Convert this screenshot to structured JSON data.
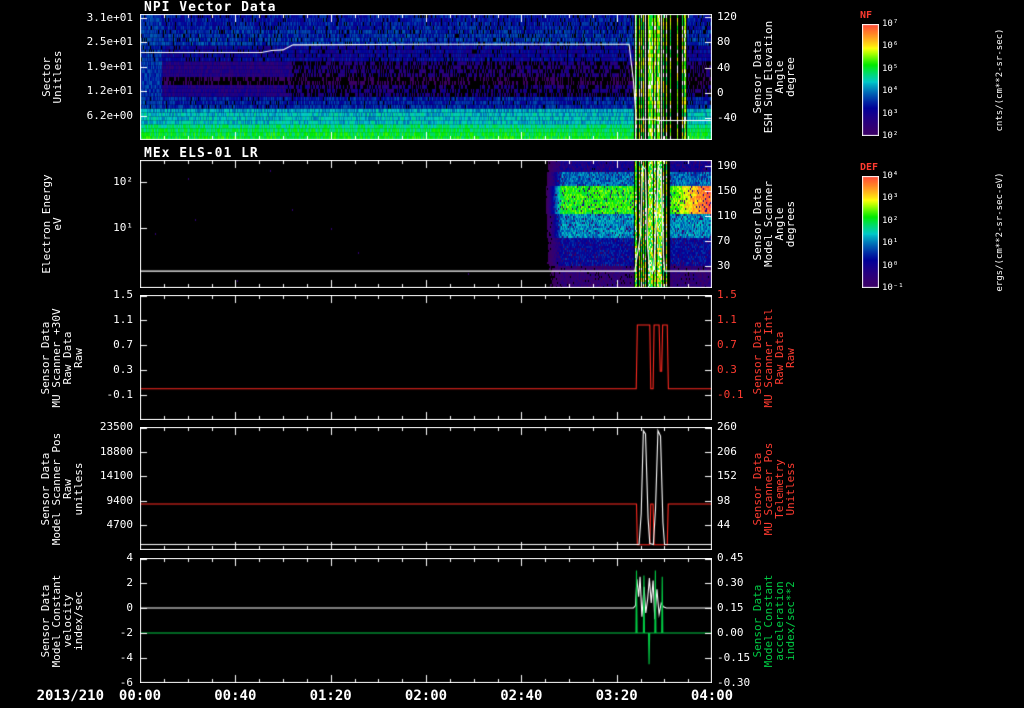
{
  "figure": {
    "background": "#000000",
    "date_label": "2013/210",
    "x_axis": {
      "tick_labels": [
        "00:00",
        "00:40",
        "01:20",
        "02:00",
        "02:40",
        "03:20",
        "04:00"
      ],
      "range_hours": [
        0,
        4
      ]
    }
  },
  "chart_data": [
    {
      "type": "heatmap",
      "title": "NPI Vector Data",
      "left_axis": {
        "label": "Sector\nUnitless",
        "scale": "linear",
        "ylim": [
          0,
          32
        ],
        "ticks": [
          {
            "label": "3.1e+01",
            "value": 31
          },
          {
            "label": "2.5e+01",
            "value": 24.8
          },
          {
            "label": "1.9e+01",
            "value": 18.6
          },
          {
            "label": "1.2e+01",
            "value": 12.4
          },
          {
            "label": "6.2e+00",
            "value": 6.2
          }
        ]
      },
      "right_axis": {
        "label": "Sensor Data\nESH Sun Elevation\nAngle\ndegree",
        "scale": "linear",
        "ylim": [
          -75,
          125
        ],
        "tick_color": "#ffffff",
        "label_color": "#ffffff",
        "ticks": [
          {
            "label": "120",
            "value": 120
          },
          {
            "label": "80",
            "value": 80
          },
          {
            "label": "40",
            "value": 40
          },
          {
            "label": "0",
            "value": 0
          },
          {
            "label": "-40",
            "value": -40
          }
        ]
      },
      "heatmap": {
        "rows": 32,
        "sector_intensity_profile": [
          0.63,
          0.62,
          0.6,
          0.57,
          0.5,
          0.5,
          0.5,
          0.48,
          0.34,
          0.33,
          0.33,
          0.22,
          0.22,
          0.2,
          0.03,
          0.03,
          0.2,
          0.2,
          0.2,
          0.2,
          0.29,
          0.28,
          0.28,
          0.28,
          0.36,
          0.36,
          0.35,
          0.35,
          0.33,
          0.33,
          0.32,
          0.32
        ],
        "uniform_start_hours": 0.15,
        "event_window_hours": [
          3.45,
          3.82
        ],
        "event_mid_hours": 3.63
      },
      "overlays": [
        {
          "name": "sun-elevation-angle-line",
          "color": "#ffffff",
          "axis": "right",
          "points": [
            [
              0,
              64
            ],
            [
              0.85,
              64
            ],
            [
              0.92,
              67
            ],
            [
              1.0,
              68
            ],
            [
              1.07,
              76
            ],
            [
              2.0,
              77
            ],
            [
              3.0,
              77
            ],
            [
              3.42,
              77
            ],
            [
              3.45,
              20
            ],
            [
              3.47,
              -42
            ],
            [
              3.6,
              -42
            ],
            [
              3.62,
              -44
            ],
            [
              4,
              -44
            ]
          ]
        }
      ],
      "colorbar": {
        "title": "NF",
        "unit": "cnts/(cm**2-sr-sec)",
        "ticks": [
          "10⁷",
          "10⁶",
          "10⁵",
          "10⁴",
          "10³",
          "10²"
        ]
      }
    },
    {
      "type": "heatmap",
      "title": "MEx ELS-01 LR",
      "left_axis": {
        "label": "Electron Energy\neV",
        "scale": "log",
        "ylim": [
          0.5,
          300
        ],
        "ticks": [
          {
            "label": "10²",
            "value": 100
          },
          {
            "label": "10¹",
            "value": 10
          }
        ]
      },
      "right_axis": {
        "label": "Sensor Data\nModel Scanner\nAngle\ndegrees",
        "scale": "linear",
        "ylim": [
          -5,
          200
        ],
        "tick_color": "#ffffff",
        "label_color": "#ffffff",
        "ticks": [
          {
            "label": "190",
            "value": 190
          },
          {
            "label": "150",
            "value": 150
          },
          {
            "label": "110",
            "value": 110
          },
          {
            "label": "70",
            "value": 70
          },
          {
            "label": "30",
            "value": 30
          }
        ]
      },
      "heatmap": {
        "start_hours": 2.83,
        "event_window_hours": [
          3.45,
          3.7
        ],
        "bands": [
          {
            "f0": 0.0,
            "f1": 0.18,
            "v": 0.14
          },
          {
            "f0": 0.18,
            "f1": 0.4,
            "v": 0.3
          },
          {
            "f0": 0.4,
            "f1": 0.58,
            "v": 0.46
          },
          {
            "f0": 0.58,
            "f1": 0.8,
            "v": 0.66
          },
          {
            "f0": 0.8,
            "f1": 0.92,
            "v": 0.42
          },
          {
            "f0": 0.92,
            "f1": 1.01,
            "v": 0.24
          }
        ],
        "post_event_hot_band": {
          "f0": 0.58,
          "f1": 0.8,
          "max_boost": 0.3
        }
      },
      "overlays": [
        {
          "name": "scanner-angle-line",
          "color": "#ffffff",
          "axis": "right",
          "points": [
            [
              0,
              22
            ],
            [
              3.46,
              22
            ],
            [
              3.5,
              80
            ],
            [
              3.515,
              190
            ],
            [
              3.535,
              185
            ],
            [
              3.55,
              60
            ],
            [
              3.565,
              22
            ],
            [
              3.59,
              22
            ],
            [
              3.61,
              95
            ],
            [
              3.625,
              190
            ],
            [
              3.645,
              180
            ],
            [
              3.66,
              50
            ],
            [
              3.67,
              22
            ],
            [
              4,
              22
            ]
          ]
        }
      ],
      "colorbar": {
        "title": "DEF",
        "unit": "ergs/(cm**2-sr-sec-eV)",
        "ticks": [
          "10⁴",
          "10³",
          "10²",
          "10¹",
          "10⁰",
          "10⁻¹"
        ]
      }
    },
    {
      "type": "line",
      "title": "",
      "left_axis": {
        "label": "Sensor Data\nMU Scanner +30V\nRaw Data\nRaw",
        "scale": "linear",
        "ylim": [
          -0.5,
          1.5
        ],
        "ticks": [
          {
            "label": "1.5",
            "value": 1.5
          },
          {
            "label": "1.1",
            "value": 1.1
          },
          {
            "label": "0.7",
            "value": 0.7
          },
          {
            "label": "0.3",
            "value": 0.3
          },
          {
            "label": "-0.1",
            "value": -0.1
          }
        ]
      },
      "right_axis": {
        "label": "Sensor Data\nMU Scanner Intl\nRaw Data\nRaw",
        "scale": "linear",
        "ylim": [
          -0.5,
          1.5
        ],
        "tick_color": "#ff3b30",
        "label_color": "#ff3b30",
        "ticks": [
          {
            "label": "1.5",
            "value": 1.5
          },
          {
            "label": "1.1",
            "value": 1.1
          },
          {
            "label": "0.7",
            "value": 0.7
          },
          {
            "label": "0.3",
            "value": 0.3
          },
          {
            "label": "-0.1",
            "value": -0.1
          }
        ]
      },
      "series": [
        {
          "name": "mu-scanner-raw",
          "color": "#ff2a20",
          "axis": "left",
          "points": [
            [
              0,
              0
            ],
            [
              3.47,
              0
            ],
            [
              3.478,
              1.02
            ],
            [
              3.565,
              1.02
            ],
            [
              3.572,
              0
            ],
            [
              3.588,
              0
            ],
            [
              3.595,
              1.02
            ],
            [
              3.63,
              1.02
            ],
            [
              3.638,
              0.28
            ],
            [
              3.648,
              0.28
            ],
            [
              3.655,
              1.02
            ],
            [
              3.687,
              1.02
            ],
            [
              3.695,
              0
            ],
            [
              4,
              0
            ]
          ]
        }
      ]
    },
    {
      "type": "line",
      "title": "",
      "left_axis": {
        "label": "Sensor Data\nModel Scanner Pos\nRaw\nunitless",
        "scale": "linear",
        "ylim": [
          0,
          23500
        ],
        "ticks": [
          {
            "label": "23500",
            "value": 23500
          },
          {
            "label": "18800",
            "value": 18800
          },
          {
            "label": "14100",
            "value": 14100
          },
          {
            "label": "9400",
            "value": 9400
          },
          {
            "label": "4700",
            "value": 4700
          }
        ]
      },
      "right_axis": {
        "label": "Sensor Data\nMU Scanner Pos\nTelemetry\nUnitless",
        "scale": "linear",
        "ylim": [
          -10,
          260
        ],
        "tick_color": "#ffffff",
        "label_color": "#ff3b30",
        "ticks": [
          {
            "label": "260",
            "value": 260
          },
          {
            "label": "206",
            "value": 206
          },
          {
            "label": "152",
            "value": 152
          },
          {
            "label": "98",
            "value": 98
          },
          {
            "label": "44",
            "value": 44
          }
        ]
      },
      "series": [
        {
          "name": "model-scanner-pos-raw",
          "color": "#ff2a20",
          "axis": "left",
          "points": [
            [
              0,
              8800
            ],
            [
              3.472,
              8800
            ],
            [
              3.478,
              1000
            ],
            [
              3.565,
              1000
            ],
            [
              3.572,
              8800
            ],
            [
              3.588,
              8800
            ],
            [
              3.595,
              1000
            ],
            [
              3.687,
              1000
            ],
            [
              3.694,
              8800
            ],
            [
              4,
              8800
            ]
          ]
        },
        {
          "name": "mu-scanner-pos-telemetry",
          "color": "#ffffff",
          "axis": "right",
          "points": [
            [
              0,
              2
            ],
            [
              3.46,
              2
            ],
            [
              3.49,
              2
            ],
            [
              3.505,
              70
            ],
            [
              3.52,
              252
            ],
            [
              3.535,
              245
            ],
            [
              3.553,
              60
            ],
            [
              3.565,
              4
            ],
            [
              3.59,
              2
            ],
            [
              3.605,
              80
            ],
            [
              3.622,
              252
            ],
            [
              3.64,
              240
            ],
            [
              3.657,
              50
            ],
            [
              3.668,
              2
            ],
            [
              4,
              2
            ]
          ]
        }
      ]
    },
    {
      "type": "line",
      "title": "",
      "left_axis": {
        "label": "Sensor Data\nModel Constant\nvelocity\nindex/sec",
        "scale": "linear",
        "ylim": [
          -6,
          4
        ],
        "ticks": [
          {
            "label": "4",
            "value": 4
          },
          {
            "label": "2",
            "value": 2
          },
          {
            "label": "0",
            "value": 0
          },
          {
            "label": "-2",
            "value": -2
          },
          {
            "label": "-4",
            "value": -4
          },
          {
            "label": "-6",
            "value": -6
          }
        ]
      },
      "right_axis": {
        "label": "Sensor Data\nModel Constant\nacceleration\nindex/sec**2",
        "scale": "linear",
        "ylim": [
          -0.3,
          0.45
        ],
        "tick_color": "#ffffff",
        "label_color": "#00cc44",
        "ticks": [
          {
            "label": "0.45",
            "value": 0.45
          },
          {
            "label": "0.30",
            "value": 0.3
          },
          {
            "label": "0.15",
            "value": 0.15
          },
          {
            "label": "0.00",
            "value": 0.0
          },
          {
            "label": "-0.15",
            "value": -0.15
          },
          {
            "label": "-0.30",
            "value": -0.3
          }
        ]
      },
      "series": [
        {
          "name": "model-constant-velocity",
          "color": "#ffffff",
          "axis": "left",
          "points": [
            [
              0,
              0
            ],
            [
              3.45,
              0
            ],
            [
              3.465,
              0.2
            ],
            [
              3.475,
              2.3
            ],
            [
              3.487,
              0.9
            ],
            [
              3.497,
              2.5
            ],
            [
              3.51,
              -0.7
            ],
            [
              3.525,
              1.7
            ],
            [
              3.537,
              -0.4
            ],
            [
              3.55,
              0.7
            ],
            [
              3.562,
              2.4
            ],
            [
              3.575,
              0.4
            ],
            [
              3.588,
              2.2
            ],
            [
              3.6,
              -0.9
            ],
            [
              3.615,
              1.5
            ],
            [
              3.63,
              -0.5
            ],
            [
              3.645,
              0.4
            ],
            [
              3.66,
              0.1
            ],
            [
              3.68,
              0
            ],
            [
              4,
              0
            ]
          ]
        },
        {
          "name": "model-constant-acceleration",
          "color": "#00cc44",
          "axis": "left",
          "points": [
            [
              0,
              -2
            ],
            [
              3.468,
              -2
            ],
            [
              3.472,
              3.0
            ],
            [
              3.476,
              -2
            ],
            [
              3.52,
              -2
            ],
            [
              3.524,
              2.6
            ],
            [
              3.528,
              -2
            ],
            [
              3.556,
              -2
            ],
            [
              3.56,
              -4.5
            ],
            [
              3.564,
              -2
            ],
            [
              3.6,
              -2
            ],
            [
              3.604,
              3.0
            ],
            [
              3.608,
              -2
            ],
            [
              3.648,
              -2
            ],
            [
              3.652,
              2.5
            ],
            [
              3.656,
              -2
            ],
            [
              4,
              -2
            ]
          ]
        }
      ]
    }
  ]
}
